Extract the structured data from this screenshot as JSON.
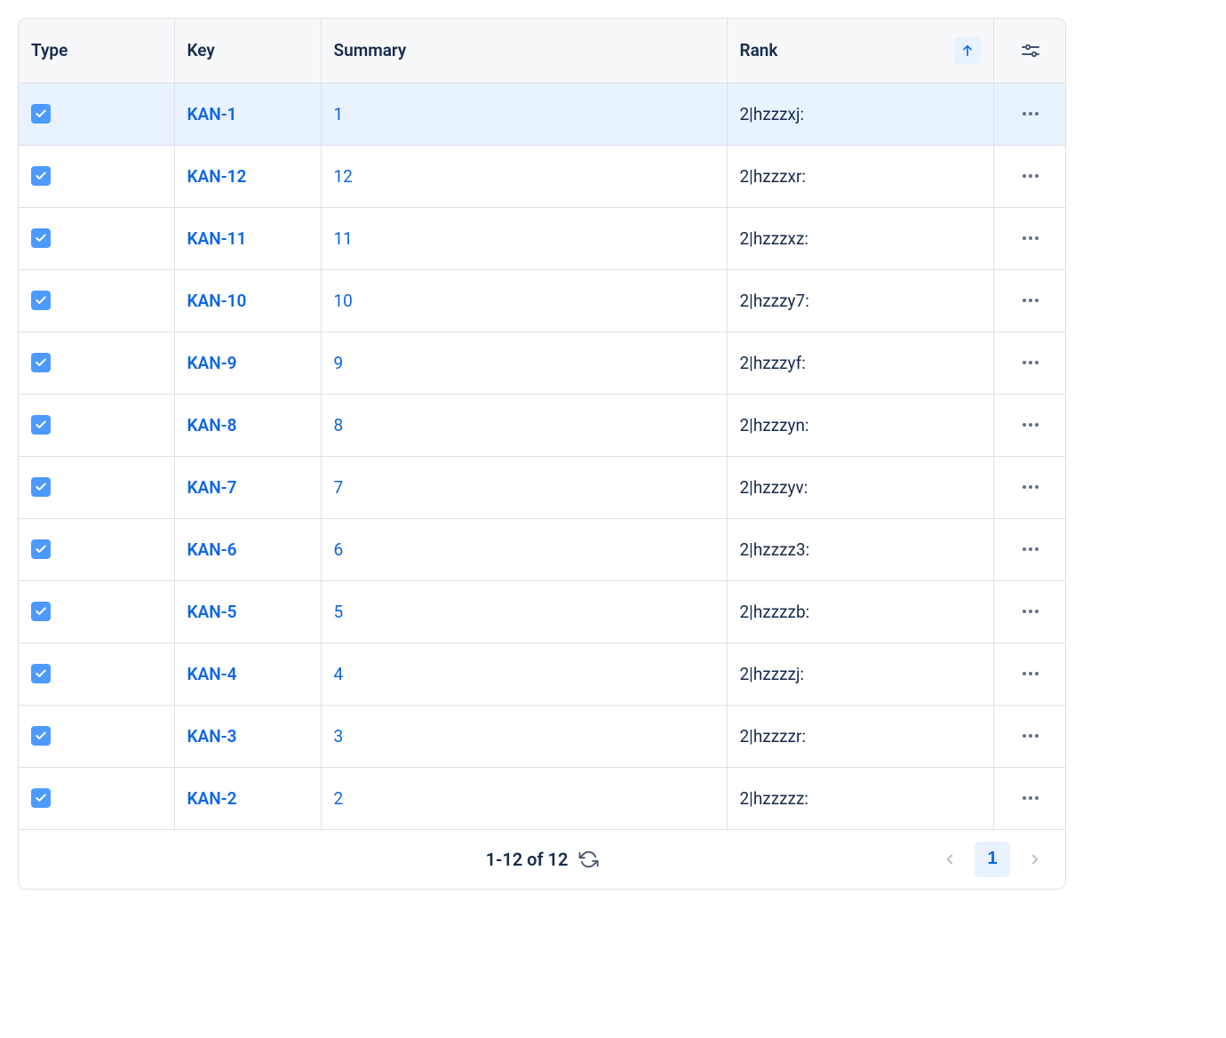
{
  "columns": {
    "type": "Type",
    "key": "Key",
    "summary": "Summary",
    "rank": "Rank"
  },
  "rows": [
    {
      "key": "KAN-1",
      "summary": "1",
      "rank": "2|hzzzxj:",
      "selected": true
    },
    {
      "key": "KAN-12",
      "summary": "12",
      "rank": "2|hzzzxr:",
      "selected": false
    },
    {
      "key": "KAN-11",
      "summary": "11",
      "rank": "2|hzzzxz:",
      "selected": false
    },
    {
      "key": "KAN-10",
      "summary": "10",
      "rank": "2|hzzzy7:",
      "selected": false
    },
    {
      "key": "KAN-9",
      "summary": "9",
      "rank": "2|hzzzyf:",
      "selected": false
    },
    {
      "key": "KAN-8",
      "summary": "8",
      "rank": "2|hzzzyn:",
      "selected": false
    },
    {
      "key": "KAN-7",
      "summary": "7",
      "rank": "2|hzzzyv:",
      "selected": false
    },
    {
      "key": "KAN-6",
      "summary": "6",
      "rank": "2|hzzzz3:",
      "selected": false
    },
    {
      "key": "KAN-5",
      "summary": "5",
      "rank": "2|hzzzzb:",
      "selected": false
    },
    {
      "key": "KAN-4",
      "summary": "4",
      "rank": "2|hzzzzj:",
      "selected": false
    },
    {
      "key": "KAN-3",
      "summary": "3",
      "rank": "2|hzzzzr:",
      "selected": false
    },
    {
      "key": "KAN-2",
      "summary": "2",
      "rank": "2|hzzzzz:",
      "selected": false
    }
  ],
  "footer": {
    "range_text": "1-12 of 12",
    "current_page": "1"
  }
}
